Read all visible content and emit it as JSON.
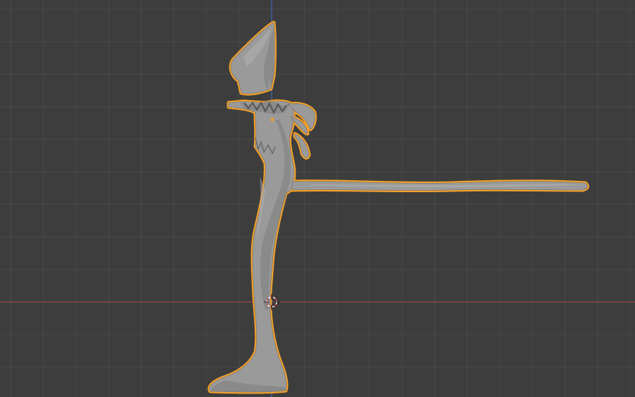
{
  "viewport": {
    "background": "#3d3d3d",
    "grid_color": "#4a4a4a",
    "x_axis_color": "#b8484f",
    "z_axis_color": "#3d6ec2"
  },
  "selected_object": {
    "fill": "#9a9a9a",
    "shade": "#7d7d7d",
    "highlight": "#b4b4b4",
    "outline": "#f2a02b",
    "origin": "#f2a02b"
  },
  "cursor_3d": {
    "ring_a": "#ffffff",
    "ring_b": "#d33a3a"
  }
}
